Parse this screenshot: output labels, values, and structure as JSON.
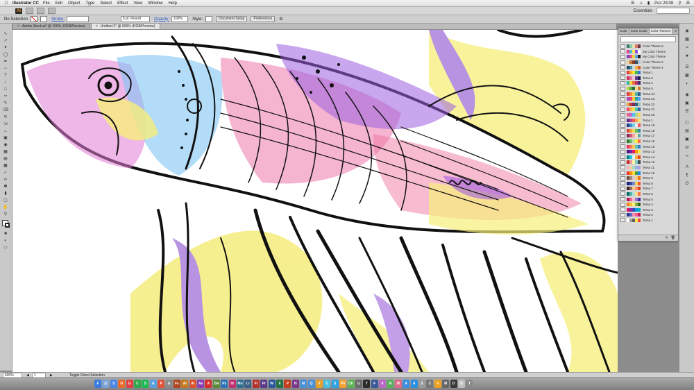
{
  "menubar": {
    "app_name": "Illustrator CC",
    "menus": [
      "File",
      "Edit",
      "Object",
      "Type",
      "Select",
      "Effect",
      "View",
      "Window",
      "Help"
    ],
    "clock": "Poz 29:08"
  },
  "appbar": {
    "logo": "Ai",
    "workspace": "Essentials"
  },
  "controlbar": {
    "selection_label": "No Selection",
    "stroke_label": "Stroke:",
    "stroke_value": "",
    "brush_value": "5 pt. Round",
    "opacity_label": "Opacity:",
    "opacity_value": "100%",
    "style_label": "Style:",
    "doc_setup_label": "Document Setup",
    "preferences_label": "Preferences"
  },
  "tabs": [
    {
      "label": "Adobe Stock.ai* @ 100% (RGB/Preview)",
      "active": false
    },
    {
      "label": "Untitled-2* @ 600% (RGB/Preview)",
      "active": true
    }
  ],
  "themes_panel": {
    "tabs": [
      "Color",
      "Color Guide",
      "Color Themes"
    ],
    "active_tab": "Color Themes",
    "menu_icon": "panel-menu-icon",
    "rows": [
      {
        "name": "Color Theme 6",
        "colors": [
          "#3c7a6a",
          "#8cc9a7",
          "#e6e0b5",
          "#d97b6a",
          "#6b3b4c"
        ]
      },
      {
        "name": "My Color Theme",
        "colors": [
          "#f33c9a",
          "#46c2d4",
          "#ffe35c",
          "#8d53e0",
          "#ffffff"
        ]
      },
      {
        "name": "My Color Theme",
        "colors": [
          "#7f3fbf",
          "#e84c8b",
          "#f5d33a",
          "#54a9e0",
          "#222222"
        ]
      },
      {
        "name": "Color Theme 5",
        "colors": [
          "#e7d0a0",
          "#c47b3d",
          "#8f3f2a",
          "#3a4f66",
          "#aac4d6"
        ]
      },
      {
        "name": "Color Theme 4",
        "colors": [
          "#1d4a5e",
          "#4d8aa3",
          "#c9dfe6",
          "#f0b043",
          "#d45a2a"
        ]
      },
      {
        "name": "Tema 1",
        "colors": [
          "#ee3b3b",
          "#f7a91d",
          "#f9e22b",
          "#3dbb4b",
          "#3a73d9"
        ]
      },
      {
        "name": "Tema 6",
        "colors": [
          "#cc2e63",
          "#e8799c",
          "#f3c5d5",
          "#5b3b8f",
          "#1f1b4d"
        ]
      },
      {
        "name": "Tema 2",
        "colors": [
          "#2fb5a3",
          "#f5d43c",
          "#ef6c3e",
          "#c0306a",
          "#3a2a6e"
        ]
      },
      {
        "name": "Tema 5",
        "colors": [
          "#b7d84b",
          "#58a83d",
          "#2c6c3a",
          "#f3e08a",
          "#d07b2d"
        ]
      },
      {
        "name": "Tema 24",
        "colors": [
          "#e03c36",
          "#f58c32",
          "#fbd44a",
          "#4cb6a6",
          "#2d5e8c"
        ]
      },
      {
        "name": "Tema 23",
        "colors": [
          "#ab47bc",
          "#ec407a",
          "#ffca28",
          "#26a69a",
          "#42a5f5"
        ]
      },
      {
        "name": "Tema 22",
        "colors": [
          "#e6a23a",
          "#c0393b",
          "#7c2d5a",
          "#2b5f7a",
          "#8fc5b6"
        ]
      },
      {
        "name": "Tema 21",
        "colors": [
          "#ef4a6b",
          "#ffb03a",
          "#f6e146",
          "#45c4b0",
          "#3a60a8"
        ]
      },
      {
        "name": "Tema 20",
        "colors": [
          "#f06292",
          "#ba68c8",
          "#4fc3f7",
          "#aed581",
          "#ffd54f"
        ]
      },
      {
        "name": "Tema 1",
        "colors": [
          "#5c2d91",
          "#b3418c",
          "#f05a5a",
          "#f9a34b",
          "#f8e16c"
        ]
      },
      {
        "name": "Tema 19",
        "colors": [
          "#263c8a",
          "#3f8fd1",
          "#74d1ea",
          "#f2f2f2",
          "#f25c54"
        ]
      },
      {
        "name": "Tema 18",
        "colors": [
          "#d9463f",
          "#f09d3a",
          "#f4d958",
          "#6bbf59",
          "#2f8f9d"
        ]
      },
      {
        "name": "Tema 17",
        "colors": [
          "#8a2b5b",
          "#d3537a",
          "#f7a4a4",
          "#fde3c4",
          "#5fa8a0"
        ]
      },
      {
        "name": "Tema 16",
        "colors": [
          "#2e7d32",
          "#66bb6a",
          "#c5e1a5",
          "#ffeb3b",
          "#ff7043"
        ]
      },
      {
        "name": "Tema 15",
        "colors": [
          "#e7396b",
          "#f7774e",
          "#fcc24e",
          "#5ec4a7",
          "#3b7bbf"
        ]
      },
      {
        "name": "Tema 13",
        "colors": [
          "#4a148c",
          "#7b1fa2",
          "#e91e63",
          "#ff9800",
          "#ffeb3b"
        ]
      },
      {
        "name": "Tema 14",
        "colors": [
          "#00838f",
          "#26c6da",
          "#e0f7fa",
          "#ffab40",
          "#e64a19"
        ]
      },
      {
        "name": "Tema 12",
        "colors": [
          "#c62828",
          "#ef9a9a",
          "#fff59d",
          "#80cbc4",
          "#37474f"
        ]
      },
      {
        "name": "Tema 11",
        "colors": [
          "#f4b6c2",
          "#f2d0a4",
          "#a8d8b9",
          "#8fb8de",
          "#b39ddb"
        ]
      },
      {
        "name": "Tema 10",
        "colors": [
          "#e53935",
          "#fb8c00",
          "#fdd835",
          "#43a047",
          "#1e88e5"
        ]
      },
      {
        "name": "Tema 9",
        "colors": [
          "#6d4c41",
          "#a1887f",
          "#d7ccc8",
          "#ffcc80",
          "#ef6c00"
        ]
      },
      {
        "name": "Tema 8",
        "colors": [
          "#1a237e",
          "#3949ab",
          "#7986cb",
          "#ffd54f",
          "#f4511e"
        ]
      },
      {
        "name": "Tema 7",
        "colors": [
          "#3e2723",
          "#8d6e63",
          "#ffcc80",
          "#ff8a65",
          "#d84315"
        ]
      },
      {
        "name": "Tema 6",
        "colors": [
          "#00695c",
          "#4db6ac",
          "#b2dfdb",
          "#ffe082",
          "#ff7043"
        ]
      },
      {
        "name": "Tema 5",
        "colors": [
          "#ad1457",
          "#f06292",
          "#f8bbd0",
          "#9575cd",
          "#4527a0"
        ]
      },
      {
        "name": "Tema 4",
        "colors": [
          "#f57f17",
          "#fbc02d",
          "#fff176",
          "#7cb342",
          "#33691e"
        ]
      },
      {
        "name": "Tema 3",
        "colors": [
          "#d81b60",
          "#8e24aa",
          "#3949ab",
          "#039be5",
          "#00acc1"
        ]
      },
      {
        "name": "Tema 2",
        "colors": [
          "#283593",
          "#5c6bc0",
          "#f48fb1",
          "#f06292",
          "#c2185b"
        ]
      },
      {
        "name": "Tema 1",
        "colors": [
          "#ffffff",
          "#9e9e9e",
          "#616161",
          "#ffeb3b",
          "#f44336"
        ]
      }
    ]
  },
  "status": {
    "zoom": "600%",
    "artboard": "1",
    "tool": "Toggle Direct Selection"
  },
  "dock_apps": [
    {
      "label": "F",
      "color": "#3b7be0"
    },
    {
      "label": "@",
      "color": "#7aa3d8"
    },
    {
      "label": "S",
      "color": "#4a86e8"
    },
    {
      "label": "O",
      "color": "#e86a2b"
    },
    {
      "label": "G",
      "color": "#e24040"
    },
    {
      "label": "C",
      "color": "#2fa84a"
    },
    {
      "label": "S",
      "color": "#1db954"
    },
    {
      "label": "A",
      "color": "#5aa0e0"
    },
    {
      "label": "P",
      "color": "#e0543a"
    },
    {
      "label": "G",
      "color": "#8a8a8a"
    },
    {
      "label": "Fs",
      "color": "#b0461f"
    },
    {
      "label": "Ai",
      "color": "#c47a1c"
    },
    {
      "label": "Ai",
      "color": "#d9532e"
    },
    {
      "label": "Ae",
      "color": "#8c3fb5"
    },
    {
      "label": "A",
      "color": "#d62e2e"
    },
    {
      "label": "Dw",
      "color": "#5b8a3a"
    },
    {
      "label": "Ps",
      "color": "#2d73b8"
    },
    {
      "label": "Id",
      "color": "#c03070"
    },
    {
      "label": "Mu",
      "color": "#2f6f8f"
    },
    {
      "label": "Lr",
      "color": "#3b5f86"
    },
    {
      "label": "Fl",
      "color": "#b5322c"
    },
    {
      "label": "Pr",
      "color": "#5a3a8a"
    },
    {
      "label": "W",
      "color": "#2b579a"
    },
    {
      "label": "X",
      "color": "#217346"
    },
    {
      "label": "P",
      "color": "#c43e1c"
    },
    {
      "label": "N",
      "color": "#7a3a8a"
    },
    {
      "label": "M",
      "color": "#4a90d9"
    },
    {
      "label": "Q",
      "color": "#4a90d9"
    },
    {
      "label": "V",
      "color": "#e3a22b"
    },
    {
      "label": "C",
      "color": "#4ac0e0"
    },
    {
      "label": "S",
      "color": "#2fa3e0"
    },
    {
      "label": "Ph",
      "color": "#f2a030"
    },
    {
      "label": "Ch",
      "color": "#5ab552"
    },
    {
      "label": "G",
      "color": "#6a6a6a"
    },
    {
      "label": "T",
      "color": "#2b2b2b"
    },
    {
      "label": "F",
      "color": "#3b5998"
    },
    {
      "label": "#",
      "color": "#ba68c8"
    },
    {
      "label": "N",
      "color": "#5aaf5a"
    },
    {
      "label": "M",
      "color": "#e06a8a"
    },
    {
      "label": "A",
      "color": "#3a8fe0"
    },
    {
      "label": "A",
      "color": "#2a8fe0"
    },
    {
      "label": "S",
      "color": "#9a9a9a"
    },
    {
      "label": "C",
      "color": "#777777"
    },
    {
      "label": "V",
      "color": "#f0a020"
    },
    {
      "label": "M",
      "color": "#666666"
    },
    {
      "label": "D",
      "color": "#3a3a3a"
    },
    {
      "label": "B",
      "color": "#c0c0c0"
    },
    {
      "label": "T",
      "color": "#8a8a8a"
    }
  ]
}
